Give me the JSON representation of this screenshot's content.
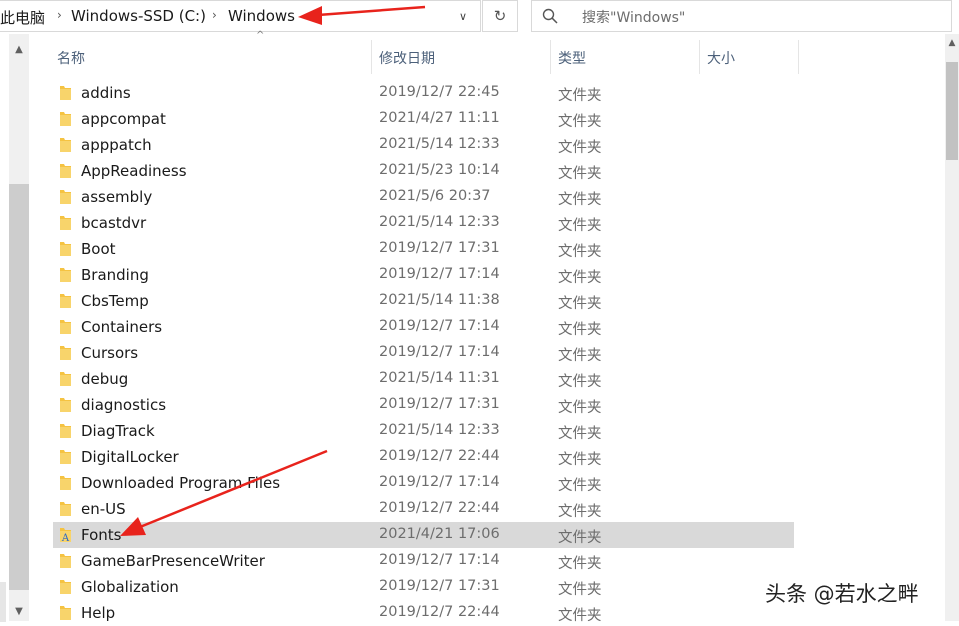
{
  "address_bar": {
    "crumbs": [
      "此电脑",
      "Windows-SSD (C:)",
      "Windows"
    ]
  },
  "search": {
    "placeholder": "搜索\"Windows\""
  },
  "columns": {
    "name": "名称",
    "date": "修改日期",
    "type": "类型",
    "size": "大小"
  },
  "files": [
    {
      "name": "addins",
      "date": "2019/12/7 22:45",
      "type": "文件夹"
    },
    {
      "name": "appcompat",
      "date": "2021/4/27 11:11",
      "type": "文件夹"
    },
    {
      "name": "apppatch",
      "date": "2021/5/14 12:33",
      "type": "文件夹"
    },
    {
      "name": "AppReadiness",
      "date": "2021/5/23 10:14",
      "type": "文件夹"
    },
    {
      "name": "assembly",
      "date": "2021/5/6 20:37",
      "type": "文件夹"
    },
    {
      "name": "bcastdvr",
      "date": "2021/5/14 12:33",
      "type": "文件夹"
    },
    {
      "name": "Boot",
      "date": "2019/12/7 17:31",
      "type": "文件夹"
    },
    {
      "name": "Branding",
      "date": "2019/12/7 17:14",
      "type": "文件夹"
    },
    {
      "name": "CbsTemp",
      "date": "2021/5/14 11:38",
      "type": "文件夹"
    },
    {
      "name": "Containers",
      "date": "2019/12/7 17:14",
      "type": "文件夹"
    },
    {
      "name": "Cursors",
      "date": "2019/12/7 17:14",
      "type": "文件夹"
    },
    {
      "name": "debug",
      "date": "2021/5/14 11:31",
      "type": "文件夹"
    },
    {
      "name": "diagnostics",
      "date": "2019/12/7 17:31",
      "type": "文件夹"
    },
    {
      "name": "DiagTrack",
      "date": "2021/5/14 12:33",
      "type": "文件夹"
    },
    {
      "name": "DigitalLocker",
      "date": "2019/12/7 22:44",
      "type": "文件夹"
    },
    {
      "name": "Downloaded Program Files",
      "date": "2019/12/7 17:14",
      "type": "文件夹"
    },
    {
      "name": "en-US",
      "date": "2019/12/7 22:44",
      "type": "文件夹"
    },
    {
      "name": "Fonts",
      "date": "2021/4/21 17:06",
      "type": "文件夹",
      "selected": true,
      "icon": "fonts-folder-icon"
    },
    {
      "name": "GameBarPresenceWriter",
      "date": "2019/12/7 17:14",
      "type": "文件夹"
    },
    {
      "name": "Globalization",
      "date": "2019/12/7 17:31",
      "type": "文件夹"
    },
    {
      "name": "Help",
      "date": "2019/12/7 22:44",
      "type": "文件夹"
    }
  ],
  "watermark": "头条 @若水之畔",
  "colors": {
    "selected_row": "#d9d9d9",
    "header_text": "#4c607a",
    "folder": "#f5c342",
    "annotation": "#e8231c"
  }
}
